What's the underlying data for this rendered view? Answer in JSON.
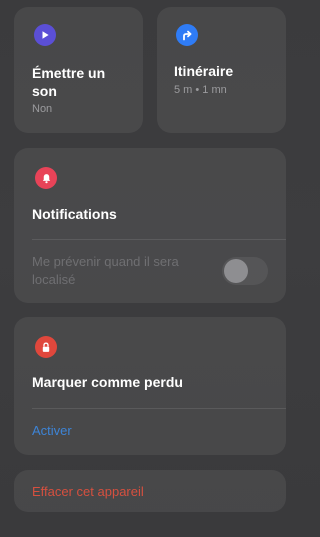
{
  "play_sound": {
    "title": "Émettre un son",
    "subtitle": "Non",
    "icon": "play-icon",
    "icon_color": "#5b4fd6"
  },
  "directions": {
    "title": "Itinéraire",
    "subtitle": "5 m • 1 mn",
    "icon": "turn-right-arrow-icon",
    "icon_color": "#2f7cf6"
  },
  "notifications": {
    "title": "Notifications",
    "icon": "bell-icon",
    "icon_color": "#e84358",
    "notify_when_found_label": "Me prévenir quand il sera localisé",
    "notify_when_found_enabled": false
  },
  "lost_mode": {
    "title": "Marquer comme perdu",
    "icon": "lock-icon",
    "icon_color": "#e0473c",
    "activate_label": "Activer"
  },
  "erase": {
    "label": "Effacer cet appareil"
  }
}
